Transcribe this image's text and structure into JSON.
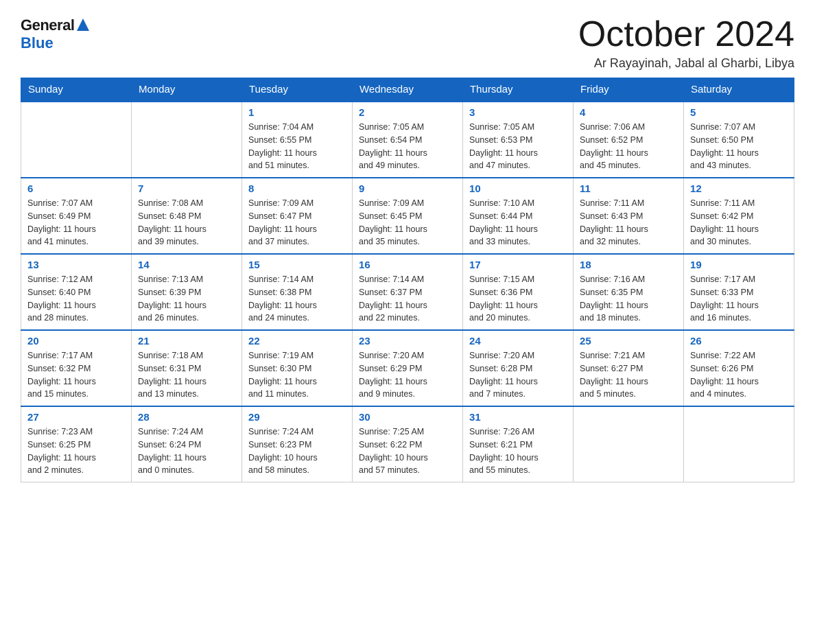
{
  "header": {
    "logo_general": "General",
    "logo_blue": "Blue",
    "month_title": "October 2024",
    "location": "Ar Rayayinah, Jabal al Gharbi, Libya"
  },
  "weekdays": [
    "Sunday",
    "Monday",
    "Tuesday",
    "Wednesday",
    "Thursday",
    "Friday",
    "Saturday"
  ],
  "weeks": [
    [
      {
        "day": "",
        "info": ""
      },
      {
        "day": "",
        "info": ""
      },
      {
        "day": "1",
        "info": "Sunrise: 7:04 AM\nSunset: 6:55 PM\nDaylight: 11 hours\nand 51 minutes."
      },
      {
        "day": "2",
        "info": "Sunrise: 7:05 AM\nSunset: 6:54 PM\nDaylight: 11 hours\nand 49 minutes."
      },
      {
        "day": "3",
        "info": "Sunrise: 7:05 AM\nSunset: 6:53 PM\nDaylight: 11 hours\nand 47 minutes."
      },
      {
        "day": "4",
        "info": "Sunrise: 7:06 AM\nSunset: 6:52 PM\nDaylight: 11 hours\nand 45 minutes."
      },
      {
        "day": "5",
        "info": "Sunrise: 7:07 AM\nSunset: 6:50 PM\nDaylight: 11 hours\nand 43 minutes."
      }
    ],
    [
      {
        "day": "6",
        "info": "Sunrise: 7:07 AM\nSunset: 6:49 PM\nDaylight: 11 hours\nand 41 minutes."
      },
      {
        "day": "7",
        "info": "Sunrise: 7:08 AM\nSunset: 6:48 PM\nDaylight: 11 hours\nand 39 minutes."
      },
      {
        "day": "8",
        "info": "Sunrise: 7:09 AM\nSunset: 6:47 PM\nDaylight: 11 hours\nand 37 minutes."
      },
      {
        "day": "9",
        "info": "Sunrise: 7:09 AM\nSunset: 6:45 PM\nDaylight: 11 hours\nand 35 minutes."
      },
      {
        "day": "10",
        "info": "Sunrise: 7:10 AM\nSunset: 6:44 PM\nDaylight: 11 hours\nand 33 minutes."
      },
      {
        "day": "11",
        "info": "Sunrise: 7:11 AM\nSunset: 6:43 PM\nDaylight: 11 hours\nand 32 minutes."
      },
      {
        "day": "12",
        "info": "Sunrise: 7:11 AM\nSunset: 6:42 PM\nDaylight: 11 hours\nand 30 minutes."
      }
    ],
    [
      {
        "day": "13",
        "info": "Sunrise: 7:12 AM\nSunset: 6:40 PM\nDaylight: 11 hours\nand 28 minutes."
      },
      {
        "day": "14",
        "info": "Sunrise: 7:13 AM\nSunset: 6:39 PM\nDaylight: 11 hours\nand 26 minutes."
      },
      {
        "day": "15",
        "info": "Sunrise: 7:14 AM\nSunset: 6:38 PM\nDaylight: 11 hours\nand 24 minutes."
      },
      {
        "day": "16",
        "info": "Sunrise: 7:14 AM\nSunset: 6:37 PM\nDaylight: 11 hours\nand 22 minutes."
      },
      {
        "day": "17",
        "info": "Sunrise: 7:15 AM\nSunset: 6:36 PM\nDaylight: 11 hours\nand 20 minutes."
      },
      {
        "day": "18",
        "info": "Sunrise: 7:16 AM\nSunset: 6:35 PM\nDaylight: 11 hours\nand 18 minutes."
      },
      {
        "day": "19",
        "info": "Sunrise: 7:17 AM\nSunset: 6:33 PM\nDaylight: 11 hours\nand 16 minutes."
      }
    ],
    [
      {
        "day": "20",
        "info": "Sunrise: 7:17 AM\nSunset: 6:32 PM\nDaylight: 11 hours\nand 15 minutes."
      },
      {
        "day": "21",
        "info": "Sunrise: 7:18 AM\nSunset: 6:31 PM\nDaylight: 11 hours\nand 13 minutes."
      },
      {
        "day": "22",
        "info": "Sunrise: 7:19 AM\nSunset: 6:30 PM\nDaylight: 11 hours\nand 11 minutes."
      },
      {
        "day": "23",
        "info": "Sunrise: 7:20 AM\nSunset: 6:29 PM\nDaylight: 11 hours\nand 9 minutes."
      },
      {
        "day": "24",
        "info": "Sunrise: 7:20 AM\nSunset: 6:28 PM\nDaylight: 11 hours\nand 7 minutes."
      },
      {
        "day": "25",
        "info": "Sunrise: 7:21 AM\nSunset: 6:27 PM\nDaylight: 11 hours\nand 5 minutes."
      },
      {
        "day": "26",
        "info": "Sunrise: 7:22 AM\nSunset: 6:26 PM\nDaylight: 11 hours\nand 4 minutes."
      }
    ],
    [
      {
        "day": "27",
        "info": "Sunrise: 7:23 AM\nSunset: 6:25 PM\nDaylight: 11 hours\nand 2 minutes."
      },
      {
        "day": "28",
        "info": "Sunrise: 7:24 AM\nSunset: 6:24 PM\nDaylight: 11 hours\nand 0 minutes."
      },
      {
        "day": "29",
        "info": "Sunrise: 7:24 AM\nSunset: 6:23 PM\nDaylight: 10 hours\nand 58 minutes."
      },
      {
        "day": "30",
        "info": "Sunrise: 7:25 AM\nSunset: 6:22 PM\nDaylight: 10 hours\nand 57 minutes."
      },
      {
        "day": "31",
        "info": "Sunrise: 7:26 AM\nSunset: 6:21 PM\nDaylight: 10 hours\nand 55 minutes."
      },
      {
        "day": "",
        "info": ""
      },
      {
        "day": "",
        "info": ""
      }
    ]
  ]
}
